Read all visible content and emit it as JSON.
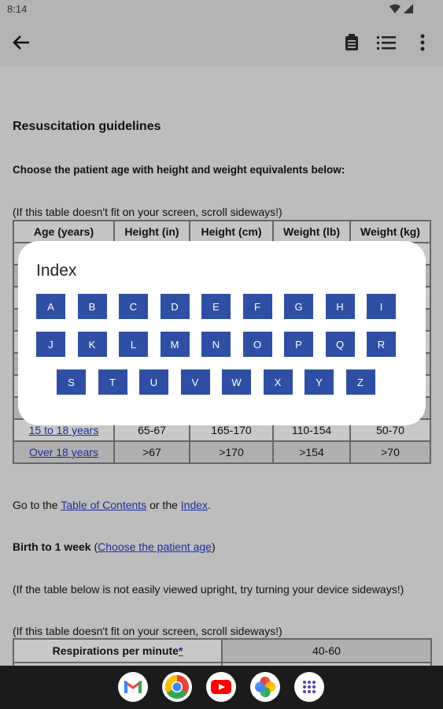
{
  "status": {
    "time": "8:14"
  },
  "content": {
    "heading": "Resuscitation guidelines",
    "choose_text": "Choose the patient age with height and weight equivalents below:",
    "scroll_note": "(If this table doesn't fit on your screen, scroll sideways!)",
    "table": {
      "headers": [
        "Age (years)",
        "Height (in)",
        "Height (cm)",
        "Weight (lb)",
        "Weight (kg)"
      ],
      "rows": [
        {
          "age": "15 to 18 years",
          "h_in": "65-67",
          "h_cm": "165-170",
          "w_lb": "110-154",
          "w_kg": "50-70"
        },
        {
          "age": "Over 18 years",
          "h_in": ">67",
          "h_cm": ">170",
          "w_lb": ">154",
          "w_kg": ">70"
        }
      ]
    },
    "goto": {
      "prefix": "Go to the ",
      "toc_link": "Table of Contents",
      "middle": " or the ",
      "index_link": "Index",
      "suffix": "."
    },
    "birth": {
      "label": "Birth to 1 week",
      "open": " (",
      "link": "Choose the patient age",
      "close": ")"
    },
    "upright_note": "(If the table below is not easily viewed upright, try turning your device sideways!)",
    "scroll_note2": "(If this table doesn't fit on your screen, scroll sideways!)",
    "resp_table": {
      "label": "Respirations per minute",
      "asterisk": "*",
      "value": "40-60"
    }
  },
  "index_dialog": {
    "title": "Index",
    "letters": [
      "A",
      "B",
      "C",
      "D",
      "E",
      "F",
      "G",
      "H",
      "I",
      "J",
      "K",
      "L",
      "M",
      "N",
      "O",
      "P",
      "Q",
      "R",
      "S",
      "T",
      "U",
      "V",
      "W",
      "X",
      "Y",
      "Z"
    ]
  },
  "colors": {
    "key": "#2e4fa3",
    "link": "#1a2f9a",
    "scrim": "#bdbdbd",
    "nav": "#1b1b1b"
  },
  "nav_apps": [
    "gmail-icon",
    "chrome-icon",
    "youtube-icon",
    "photos-icon",
    "app-drawer-icon"
  ]
}
